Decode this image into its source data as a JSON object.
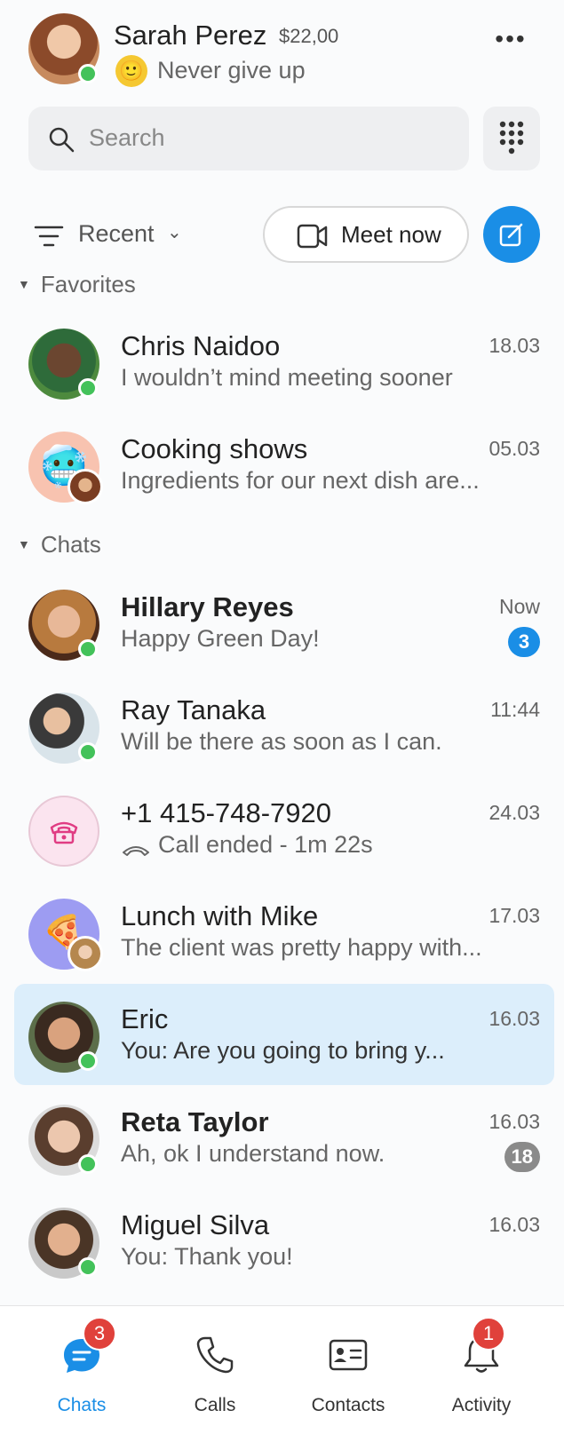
{
  "profile": {
    "name": "Sarah Perez",
    "credit": "$22,00",
    "mood_emoji": "🙂",
    "mood": "Never give up",
    "more_label": "•••"
  },
  "search": {
    "placeholder": "Search"
  },
  "filter": {
    "label": "Recent",
    "chevron": "⌄"
  },
  "meet_now": {
    "label": "Meet now"
  },
  "sections": {
    "favorites": "Favorites",
    "chats": "Chats"
  },
  "favorites": [
    {
      "name": "Chris Naidoo",
      "message": "I wouldn’t mind meeting sooner",
      "time": "18.03",
      "online": true,
      "bold": false
    },
    {
      "name": "Cooking shows",
      "message": "Ingredients for our next dish are...",
      "time": "05.03",
      "online": false,
      "bold": false,
      "emoji": "🥶"
    }
  ],
  "chats": [
    {
      "name": "Hillary Reyes",
      "message": "Happy Green Day!",
      "time": "Now",
      "online": true,
      "bold": true,
      "badge": "3",
      "badge_color": "#1a8ee6"
    },
    {
      "name": "Ray Tanaka",
      "message": "Will be there as soon as I can.",
      "time": "11:44",
      "online": true,
      "bold": false
    },
    {
      "name": "+1 415-748-7920",
      "message": "Call ended - 1m 22s",
      "time": "24.03",
      "online": false,
      "bold": false
    },
    {
      "name": "Lunch with Mike",
      "message": "The client was pretty happy with...",
      "time": "17.03",
      "online": false,
      "bold": false,
      "emoji": "🍕"
    },
    {
      "name": "Eric",
      "message": "You: Are you going to bring y...",
      "time": "16.03",
      "online": true,
      "bold": false,
      "selected": true
    },
    {
      "name": "Reta Taylor",
      "message": "Ah, ok I understand now.",
      "time": "16.03",
      "online": true,
      "bold": true,
      "badge": "18",
      "badge_color": "#8a8a8a"
    },
    {
      "name": "Miguel Silva",
      "message": "You: Thank you!",
      "time": "16.03",
      "online": true,
      "bold": false
    }
  ],
  "nav": [
    {
      "label": "Chats",
      "badge": "3",
      "active": true
    },
    {
      "label": "Calls",
      "badge": "",
      "active": false
    },
    {
      "label": "Contacts",
      "badge": "",
      "active": false
    },
    {
      "label": "Activity",
      "badge": "1",
      "active": false
    }
  ],
  "colors": {
    "accent": "#1a8ee6",
    "presence": "#43c25a",
    "selected_bg": "#dceefb",
    "badge_red": "#e0413b"
  }
}
